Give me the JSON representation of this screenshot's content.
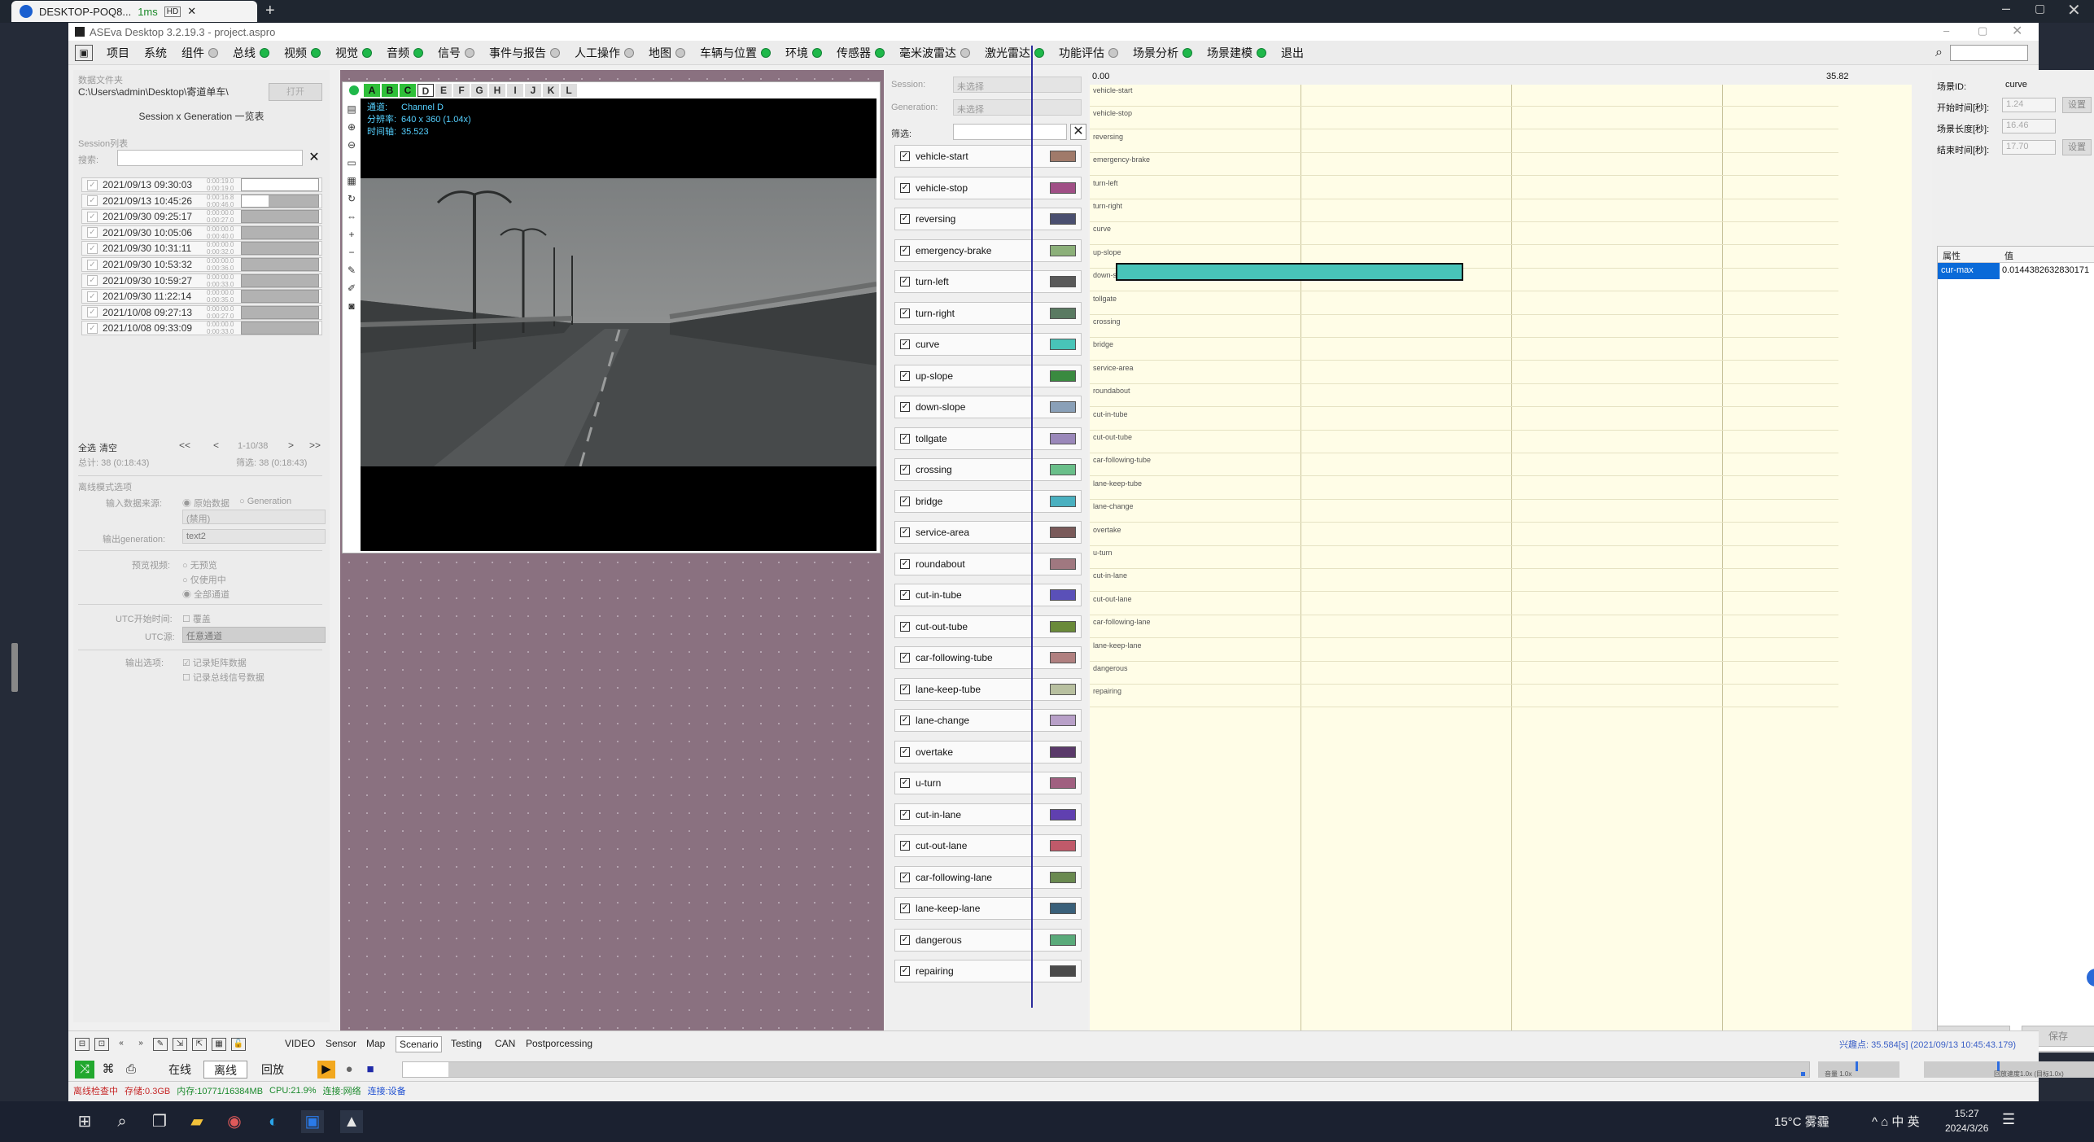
{
  "remote_tab": {
    "title": "DESKTOP-POQ8...",
    "latency": "1ms",
    "badge": "HD"
  },
  "app": {
    "title": "ASEva Desktop 3.2.19.3 - project.aspro"
  },
  "menu": [
    {
      "label": "项目",
      "dot": ""
    },
    {
      "label": "系统",
      "dot": ""
    },
    {
      "label": "组件",
      "dot": "gray"
    },
    {
      "label": "总线",
      "dot": "green"
    },
    {
      "label": "视频",
      "dot": "green"
    },
    {
      "label": "视觉",
      "dot": "green"
    },
    {
      "label": "音频",
      "dot": "green"
    },
    {
      "label": "信号",
      "dot": "gray"
    },
    {
      "label": "事件与报告",
      "dot": "gray"
    },
    {
      "label": "人工操作",
      "dot": "gray"
    },
    {
      "label": "地图",
      "dot": "gray"
    },
    {
      "label": "车辆与位置",
      "dot": "green"
    },
    {
      "label": "环境",
      "dot": "green"
    },
    {
      "label": "传感器",
      "dot": "green"
    },
    {
      "label": "毫米波雷达",
      "dot": "gray"
    },
    {
      "label": "激光雷达",
      "dot": "green"
    },
    {
      "label": "功能评估",
      "dot": "gray"
    },
    {
      "label": "场景分析",
      "dot": "green"
    },
    {
      "label": "场景建模",
      "dot": "green"
    },
    {
      "label": "退出",
      "dot": ""
    }
  ],
  "session_panel": {
    "data_folder_label": "数据文件夹",
    "data_folder_path": "C:\\Users\\admin\\Desktop\\寄道单车\\",
    "open_button": "打开",
    "mode_title": "Session x Generation 一览表",
    "list_label": "Session列表",
    "search_label": "搜索:",
    "sessions": [
      {
        "date": "2021/09/13 09:30:03",
        "dur": "0:00:19.0\n0:00:19.0",
        "bar": "white"
      },
      {
        "date": "2021/09/13 10:45:26",
        "dur": "0:00:16.8\n0:00:46.0",
        "bar": "half"
      },
      {
        "date": "2021/09/30 09:25:17",
        "dur": "0:00:00.0\n0:00:27.0",
        "bar": "gray"
      },
      {
        "date": "2021/09/30 10:05:06",
        "dur": "0:00:00.0\n0:00:40.0",
        "bar": "gray"
      },
      {
        "date": "2021/09/30 10:31:11",
        "dur": "0:00:00.0\n0:00:32.0",
        "bar": "gray"
      },
      {
        "date": "2021/09/30 10:53:32",
        "dur": "0:00:00.0\n0:00:36.0",
        "bar": "gray"
      },
      {
        "date": "2021/09/30 10:59:27",
        "dur": "0:00:00.0\n0:00:33.0",
        "bar": "gray"
      },
      {
        "date": "2021/09/30 11:22:14",
        "dur": "0:00:00.0\n0:00:35.0",
        "bar": "gray"
      },
      {
        "date": "2021/10/08 09:27:13",
        "dur": "0:00:00.0\n0:00:27.0",
        "bar": "gray"
      },
      {
        "date": "2021/10/08 09:33:09",
        "dur": "0:00:00.0\n0:00:33.0",
        "bar": "gray"
      }
    ],
    "select_all": "全选",
    "clear": "清空",
    "page_info": "1-10/38",
    "total": "总计: 38 (0:18:43)",
    "filtered": "筛选: 38 (0:18:43)",
    "offline_label": "离线模式选项",
    "input_source_label": "输入数据来源:",
    "input_raw": "原始数据",
    "input_generation": "Generation",
    "disabled_option": "(禁用)",
    "output_gen_label": "输出generation:",
    "output_gen_value": "text2",
    "preview_label": "预览视频:",
    "preview_none": "无预览",
    "preview_used": "仅使用中",
    "preview_all": "全部通道",
    "utc_start_label": "UTC开始时间:",
    "utc_override": "覆盖",
    "utc_source_label": "UTC源:",
    "utc_source_value": "任意通道",
    "output_options_label": "输出选项:",
    "output_opt1": "记录矩阵数据",
    "output_opt2": "记录总线信号数据"
  },
  "video": {
    "tabs": [
      "A",
      "B",
      "C",
      "D",
      "E",
      "F",
      "G",
      "H",
      "I",
      "J",
      "K",
      "L"
    ],
    "info_channel_k": "通道:",
    "info_channel_v": "Channel D",
    "info_res_k": "分辨率:",
    "info_res_v": "640 x 360 (1.04x)",
    "info_time_k": "时间轴:",
    "info_time_v": "35.523"
  },
  "tag_panel": {
    "session_label": "Session:",
    "session_value": "未选择",
    "generation_label": "Generation:",
    "generation_value": "未选择",
    "filter_label": "筛选:",
    "tags": [
      {
        "label": "vehicle-start",
        "color": "#a07a6a"
      },
      {
        "label": "vehicle-stop",
        "color": "#a04f86"
      },
      {
        "label": "reversing",
        "color": "#4a4f70"
      },
      {
        "label": "emergency-brake",
        "color": "#8cb07a"
      },
      {
        "label": "turn-left",
        "color": "#5a5a5a"
      },
      {
        "label": "turn-right",
        "color": "#5a7a62"
      },
      {
        "label": "curve",
        "color": "#48c4b8"
      },
      {
        "label": "up-slope",
        "color": "#3a8a40"
      },
      {
        "label": "down-slope",
        "color": "#8aa0b8"
      },
      {
        "label": "tollgate",
        "color": "#9a88ba"
      },
      {
        "label": "crossing",
        "color": "#6abf8a"
      },
      {
        "label": "bridge",
        "color": "#4ab0c0"
      },
      {
        "label": "service-area",
        "color": "#7a5a5a"
      },
      {
        "label": "roundabout",
        "color": "#a07880"
      },
      {
        "label": "cut-in-tube",
        "color": "#5a50b8"
      },
      {
        "label": "cut-out-tube",
        "color": "#6a8a3a"
      },
      {
        "label": "car-following-tube",
        "color": "#b08080"
      },
      {
        "label": "lane-keep-tube",
        "color": "#b8c0a0"
      },
      {
        "label": "lane-change",
        "color": "#b8a0c8"
      },
      {
        "label": "overtake",
        "color": "#5a3a6a"
      },
      {
        "label": "u-turn",
        "color": "#a06080"
      },
      {
        "label": "cut-in-lane",
        "color": "#6040b0"
      },
      {
        "label": "cut-out-lane",
        "color": "#c05a6a"
      },
      {
        "label": "car-following-lane",
        "color": "#6a8a50"
      },
      {
        "label": "lane-keep-lane",
        "color": "#3a607a"
      },
      {
        "label": "dangerous",
        "color": "#5aaa7a"
      },
      {
        "label": "repairing",
        "color": "#4a4a4a"
      }
    ]
  },
  "timeline": {
    "start_label": "0.00",
    "end_label": "35.82",
    "ticks": [
      "10",
      "20",
      "30"
    ],
    "lanes": [
      "vehicle-start",
      "vehicle-stop",
      "reversing",
      "emergency-brake",
      "turn-left",
      "turn-right",
      "curve",
      "up-slope",
      "down-slope",
      "tollgate",
      "crossing",
      "bridge",
      "service-area",
      "roundabout",
      "cut-in-tube",
      "cut-out-tube",
      "car-following-tube",
      "lane-keep-tube",
      "lane-change",
      "overtake",
      "u-turn",
      "cut-in-lane",
      "cut-out-lane",
      "car-following-lane",
      "lane-keep-lane",
      "dangerous",
      "repairing"
    ],
    "curve_segment": {
      "start": 1.24,
      "end": 17.7
    }
  },
  "props": {
    "scene_id_label": "场景ID:",
    "scene_id_value": "curve",
    "start_time_label": "开始时间[秒]:",
    "start_time_value": "1.24",
    "length_label": "场景长度[秒]:",
    "length_value": "16.46",
    "end_time_label": "结束时间[秒]:",
    "end_time_value": "17.70",
    "set_button": "设置",
    "col_attr": "属性",
    "col_value": "值",
    "row_key": "cur-max",
    "row_value": "0.0144382632830171",
    "reset_button": "重置",
    "save_button": "保存"
  },
  "bottom": {
    "tabs": [
      "VIDEO",
      "Sensor",
      "Map",
      "Scenario",
      "Testing",
      "CAN",
      "Postporcessing"
    ],
    "selected_tab": "Scenario",
    "interest_point": "兴趣点: 35.584[s] (2021/09/13 10:45:43.179)",
    "mode_online": "在线",
    "mode_offline": "离线",
    "mode_replay": "回放",
    "volume_label": "音量 1.0x",
    "speed_label": "回放速度1.0x (目标1.0x)"
  },
  "status": {
    "offline": "离线检查中",
    "storage": "存储:0.3GB",
    "memory": "内存:10771/16384MB",
    "cpu": "CPU:21.9%",
    "net": "连接:网络",
    "device": "连接:设备"
  },
  "taskbar": {
    "weather": "15°C 雾霾",
    "tray": "^  ⌂  中  英",
    "time": "15:27",
    "date": "2024/3/26"
  }
}
